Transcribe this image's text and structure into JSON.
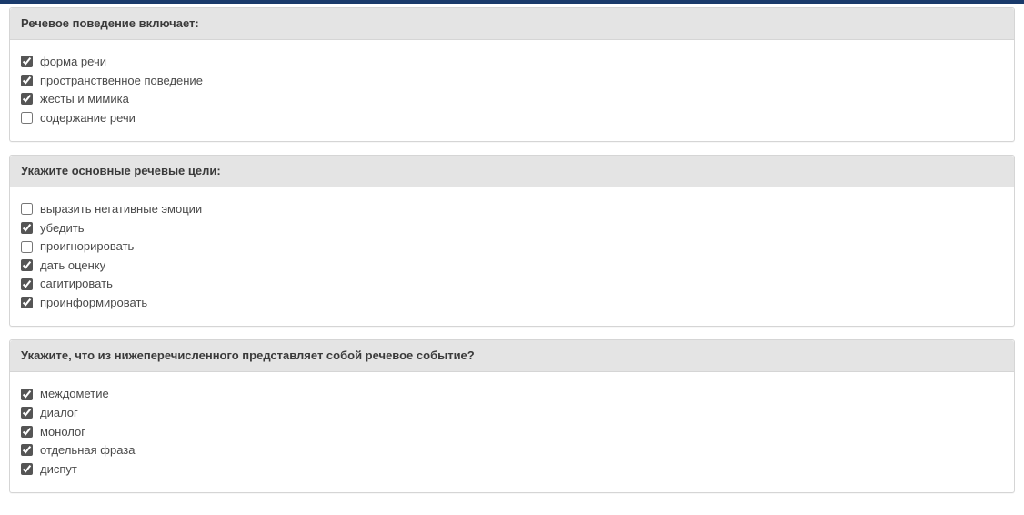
{
  "questions": [
    {
      "title": "Речевое поведение включает:",
      "options": [
        {
          "label": "форма речи",
          "checked": true
        },
        {
          "label": "пространственное поведение",
          "checked": true
        },
        {
          "label": "жесты и мимика",
          "checked": true
        },
        {
          "label": "содержание речи",
          "checked": false
        }
      ]
    },
    {
      "title": "Укажите основные речевые цели:",
      "options": [
        {
          "label": "выразить негативные эмоции",
          "checked": false
        },
        {
          "label": "убедить",
          "checked": true
        },
        {
          "label": "проигнорировать",
          "checked": false
        },
        {
          "label": "дать оценку",
          "checked": true
        },
        {
          "label": "сагитировать",
          "checked": true
        },
        {
          "label": "проинформировать",
          "checked": true
        }
      ]
    },
    {
      "title": "Укажите, что из нижеперечисленного представляет собой речевое событие?",
      "options": [
        {
          "label": "междометие",
          "checked": true
        },
        {
          "label": "диалог",
          "checked": true
        },
        {
          "label": "монолог",
          "checked": true
        },
        {
          "label": "отдельная фраза",
          "checked": true
        },
        {
          "label": "диспут",
          "checked": true
        }
      ]
    }
  ]
}
